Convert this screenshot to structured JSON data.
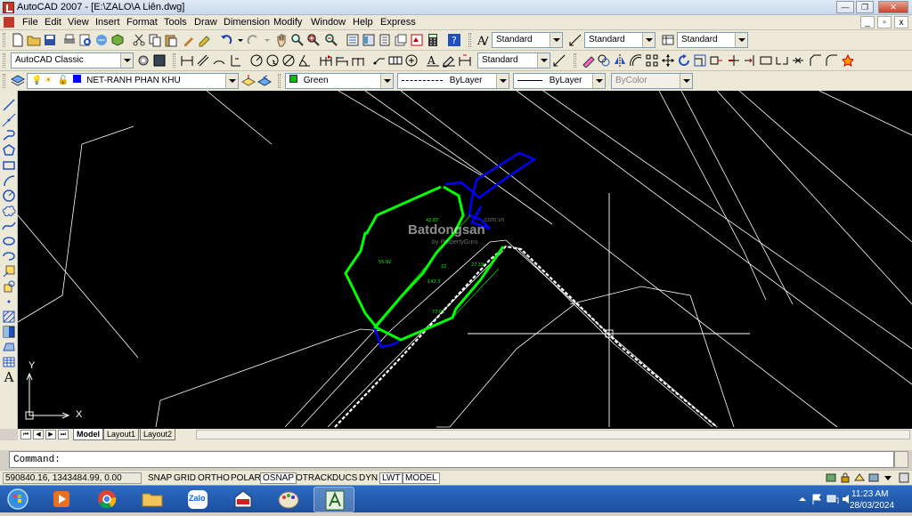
{
  "window": {
    "title": "AutoCAD 2007 - [E:\\ZALO\\A Liên.dwg]",
    "controls": {
      "minimize": "0",
      "restore": "1",
      "close": "r"
    },
    "mdi_controls": {
      "minimize": "_",
      "restore": "▫",
      "close": "x"
    }
  },
  "menu": [
    "File",
    "Edit",
    "View",
    "Insert",
    "Format",
    "Tools",
    "Draw",
    "Dimension",
    "Modify",
    "Window",
    "Help",
    "Express"
  ],
  "toolbar1": {
    "text_style": "Standard",
    "dim_style": "Standard",
    "table_style": "Standard"
  },
  "toolbar2": {
    "workspace": "AutoCAD Classic",
    "mleader_style": "Standard"
  },
  "toolbar3": {
    "layer": "NET-RANH PHAN KHU",
    "layer_color": "#0000ff",
    "color": "Green",
    "color_swatch": "#00c000",
    "linetype": "ByLayer",
    "lineweight": "ByLayer",
    "plotstyle": "ByColor"
  },
  "drawing": {
    "watermark": "Batdongsan",
    "watermark_sub": "by PropertyGuru",
    "watermark_top": ".com.vn",
    "dimensions": [
      "42.87",
      "55.92",
      "22",
      "142.3",
      "27.19",
      "77.05"
    ],
    "colors": {
      "background": "#000000",
      "boundary": "#00ff00",
      "parcel": "#0000ff",
      "lines": "#ffffff"
    },
    "ucs_x": "X",
    "ucs_y": "Y"
  },
  "tabs": {
    "nav": [
      "⏮",
      "◀",
      "▶",
      "⏭"
    ],
    "items": [
      "Model",
      "Layout1",
      "Layout2"
    ],
    "active": "Model"
  },
  "command": {
    "prompt": "Command:"
  },
  "status": {
    "coords": "590840.16, 1343484.99, 0.00",
    "buttons": [
      "SNAP",
      "GRID",
      "ORTHO",
      "POLAR",
      "OSNAP",
      "OTRACK",
      "DUCS",
      "DYN",
      "LWT",
      "MODEL"
    ],
    "active_buttons": [
      "OSNAP",
      "LWT",
      "MODEL"
    ]
  },
  "taskbar": {
    "apps": [
      "start-orb",
      "media-player",
      "chrome",
      "file-explorer",
      "zalo",
      "certificate-app",
      "paint",
      "autocad"
    ],
    "zalo_label": "Zalo",
    "time": "11:23 AM",
    "date": "28/03/2024"
  }
}
